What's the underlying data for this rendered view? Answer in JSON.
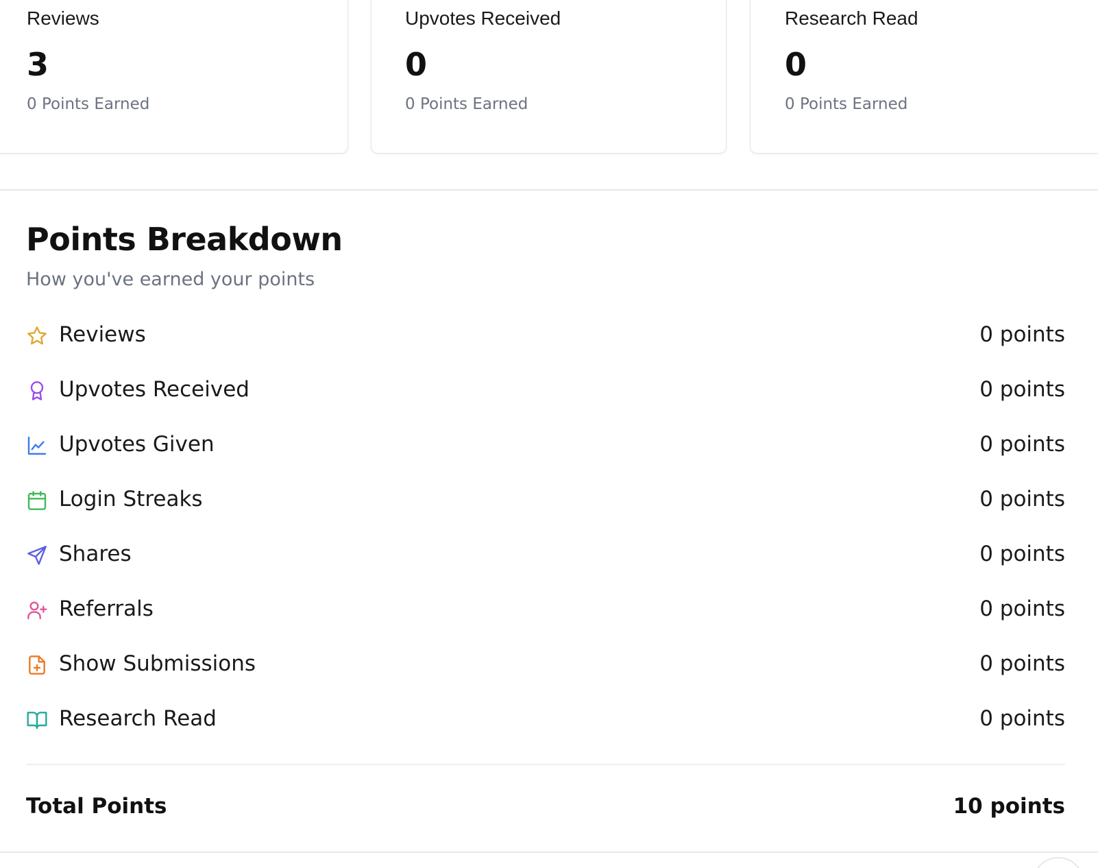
{
  "stat_cards": [
    {
      "label": "Reviews",
      "value": "3",
      "sub": "0 Points Earned"
    },
    {
      "label": "Upvotes Received",
      "value": "0",
      "sub": "0 Points Earned"
    },
    {
      "label": "Research Read",
      "value": "0",
      "sub": "0 Points Earned"
    }
  ],
  "breakdown": {
    "title": "Points Breakdown",
    "subtitle": "How you've earned your points",
    "items": [
      {
        "label": "Reviews",
        "value": "0 points",
        "icon": "star-icon",
        "color": "#e0a82e"
      },
      {
        "label": "Upvotes Received",
        "value": "0 points",
        "icon": "award-icon",
        "color": "#9b4dea"
      },
      {
        "label": "Upvotes Given",
        "value": "0 points",
        "icon": "line-chart-icon",
        "color": "#3b7de8"
      },
      {
        "label": "Login Streaks",
        "value": "0 points",
        "icon": "calendar-icon",
        "color": "#3fba57"
      },
      {
        "label": "Shares",
        "value": "0 points",
        "icon": "send-icon",
        "color": "#5b5fe0"
      },
      {
        "label": "Referrals",
        "value": "0 points",
        "icon": "user-plus-icon",
        "color": "#e0559a"
      },
      {
        "label": "Show Submissions",
        "value": "0 points",
        "icon": "file-plus-icon",
        "color": "#ec7a25"
      },
      {
        "label": "Research Read",
        "value": "0 points",
        "icon": "book-open-icon",
        "color": "#27a89a"
      }
    ],
    "total_label": "Total Points",
    "total_value": "10 points"
  }
}
